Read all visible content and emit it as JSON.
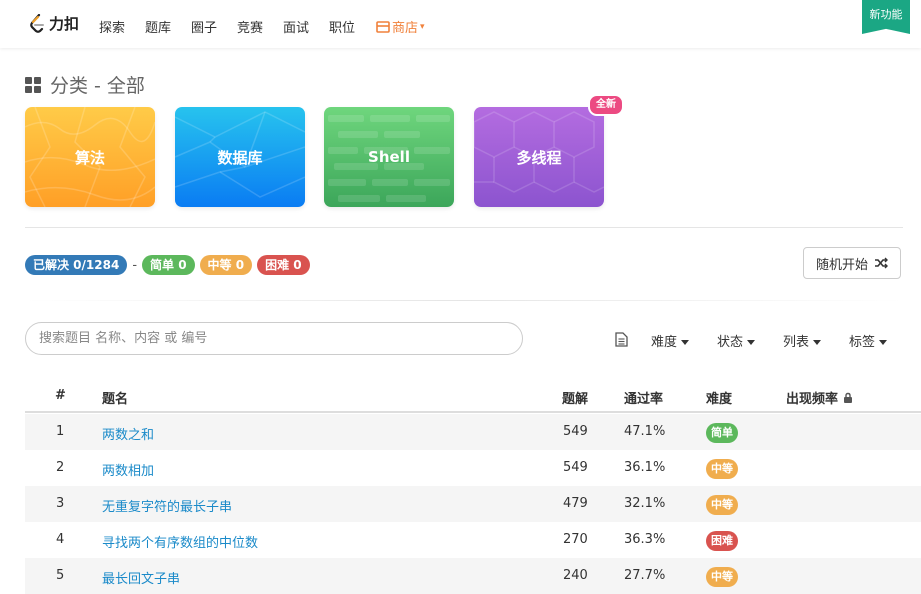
{
  "nav": {
    "logo_text": "力扣",
    "items": [
      "探索",
      "题库",
      "圈子",
      "竞赛",
      "面试",
      "职位"
    ],
    "store_label": "商店",
    "new_feature": "新功能"
  },
  "section": {
    "title": "分类 - 全部"
  },
  "categories": [
    {
      "label": "算法"
    },
    {
      "label": "数据库"
    },
    {
      "label": "Shell"
    },
    {
      "label": "多线程",
      "badge": "全新"
    }
  ],
  "stats": {
    "solved": "已解决 0/1284",
    "separator": "-",
    "easy": "简单 0",
    "medium": "中等 0",
    "hard": "困难 0"
  },
  "random_button": "随机开始",
  "search": {
    "placeholder": "搜索题目 名称、内容 或 编号"
  },
  "filters": [
    "难度",
    "状态",
    "列表",
    "标签"
  ],
  "table": {
    "headers": [
      "#",
      "题名",
      "题解",
      "通过率",
      "难度",
      "出现频率"
    ],
    "rows": [
      {
        "id": "1",
        "title": "两数之和",
        "solutions": "549",
        "rate": "47.1%",
        "difficulty": "简单"
      },
      {
        "id": "2",
        "title": "两数相加",
        "solutions": "549",
        "rate": "36.1%",
        "difficulty": "中等"
      },
      {
        "id": "3",
        "title": "无重复字符的最长子串",
        "solutions": "479",
        "rate": "32.1%",
        "difficulty": "中等"
      },
      {
        "id": "4",
        "title": "寻找两个有序数组的中位数",
        "solutions": "270",
        "rate": "36.3%",
        "difficulty": "困难"
      },
      {
        "id": "5",
        "title": "最长回文子串",
        "solutions": "240",
        "rate": "27.7%",
        "difficulty": "中等"
      }
    ]
  },
  "colors": {
    "brand_orange": "#f0813b",
    "new_feature_green": "#1ba784",
    "link": "#1a8ac9",
    "easy": "#5cb85c",
    "medium": "#f0ad4e",
    "hard": "#d9534f",
    "solved": "#337ab7"
  }
}
